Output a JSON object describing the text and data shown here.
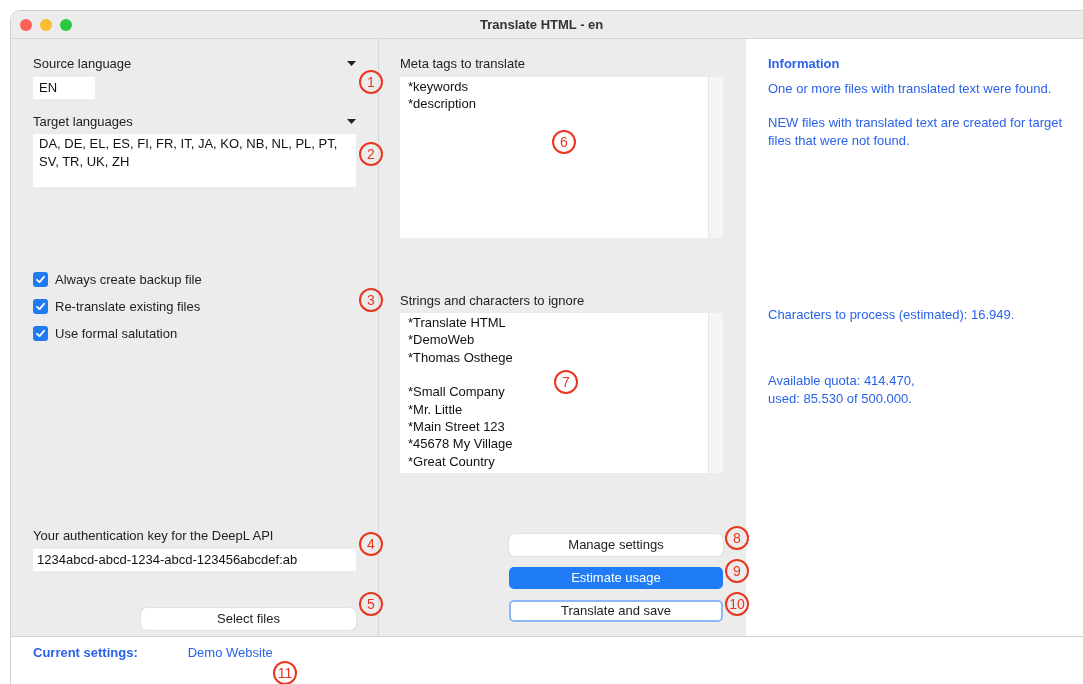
{
  "window": {
    "title": "Translate HTML - en"
  },
  "source_language": {
    "label": "Source language",
    "value": "EN"
  },
  "target_languages": {
    "label": "Target languages",
    "value": "DA, DE, EL, ES, FI, FR, IT, JA, KO, NB, NL, PL, PT, SV, TR, UK, ZH"
  },
  "options": [
    {
      "label": "Always create backup file",
      "checked": true
    },
    {
      "label": "Re-translate existing files",
      "checked": true
    },
    {
      "label": "Use formal salutation",
      "checked": true
    }
  ],
  "auth_key": {
    "label": "Your authentication key for the DeepL API",
    "value": "1234abcd-abcd-1234-abcd-123456abcdef:ab"
  },
  "select_files_button": "Select files",
  "meta_tags": {
    "label": "Meta tags to translate",
    "groups": [
      [
        "*keywords",
        "*description"
      ]
    ]
  },
  "ignore": {
    "label": "Strings and characters to ignore",
    "groups": [
      [
        "*Translate HTML",
        "*DemoWeb",
        "*Thomas Osthege"
      ],
      [
        "*Small Company",
        "*Mr. Little",
        "*Main Street 123",
        "*45678 My Village",
        "*Great Country"
      ]
    ]
  },
  "buttons": [
    {
      "label": "Manage settings",
      "kind": "plain"
    },
    {
      "label": "Estimate usage",
      "kind": "primary"
    },
    {
      "label": "Translate and save",
      "kind": "focused"
    }
  ],
  "information": {
    "title": "Information",
    "files_found": "One or more files with translated text were found.",
    "new_files": "NEW files with translated text are created for target files that were not found.",
    "characters": "Characters to process (estimated): 16.949.",
    "quota": [
      "Available quota: 414.470,",
      "used: 85.530 of 500.000."
    ]
  },
  "current_settings": {
    "label": "Current settings:",
    "value": "Demo Website"
  },
  "callouts": [
    "1",
    "2",
    "3",
    "4",
    "5",
    "6",
    "7",
    "8",
    "9",
    "10",
    "11"
  ]
}
